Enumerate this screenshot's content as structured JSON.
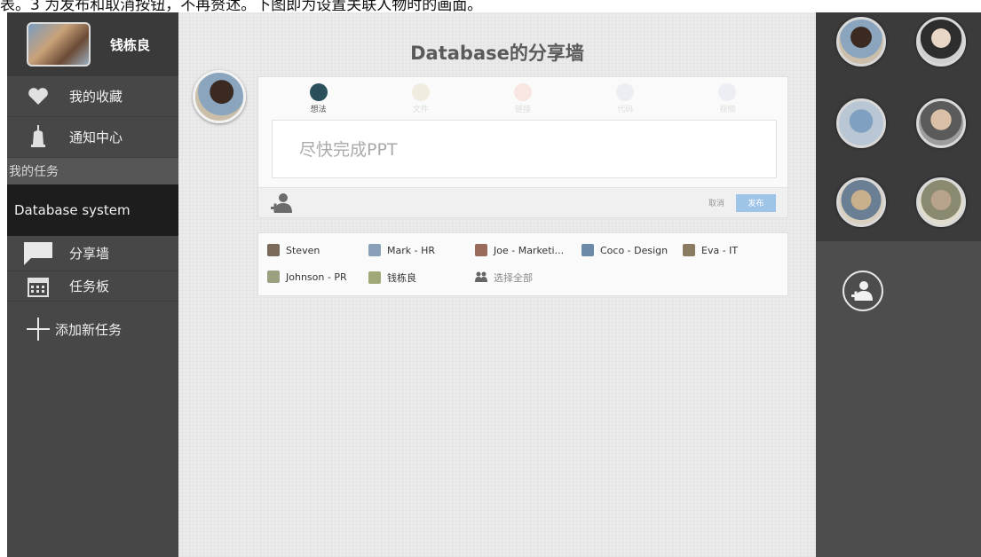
{
  "doc_caption": "表。3 为发布和取消按钮，不再赘述。下图即为设置关联人物时的画面。",
  "sidebar": {
    "user_name": "钱栋良",
    "favorites_label": "我的收藏",
    "notifications_label": "通知中心",
    "my_tasks_label": "我的任务",
    "current_task": "Database system",
    "share_wall_label": "分享墙",
    "task_board_label": "任务板",
    "add_task_label": "添加新任务"
  },
  "main": {
    "title": "Database的分享墙",
    "composer": {
      "tabs": [
        {
          "label": "想法",
          "icon": "lightbulb-icon",
          "active": true
        },
        {
          "label": "文件",
          "icon": "file-icon",
          "active": false
        },
        {
          "label": "链接",
          "icon": "link-icon",
          "active": false
        },
        {
          "label": "代码",
          "icon": "code-icon",
          "active": false
        },
        {
          "label": "视频",
          "icon": "video-icon",
          "active": false
        }
      ],
      "input_value": "尽快完成PPT",
      "cancel_label": "取消",
      "publish_label": "发布"
    },
    "contacts": [
      {
        "name": "Steven"
      },
      {
        "name": "Mark - HR"
      },
      {
        "name": "Joe - Marketi..."
      },
      {
        "name": "Coco - Design"
      },
      {
        "name": "Eva - IT"
      },
      {
        "name": "Johnson - PR"
      },
      {
        "name": "钱栋良"
      },
      {
        "name": "选择全部"
      }
    ]
  },
  "colors": {
    "sidebar_bg": "#474747",
    "main_bg": "#ebebeb",
    "publish_button": "#9ec4e8",
    "right_panel_bg": "#4d4d4d"
  }
}
